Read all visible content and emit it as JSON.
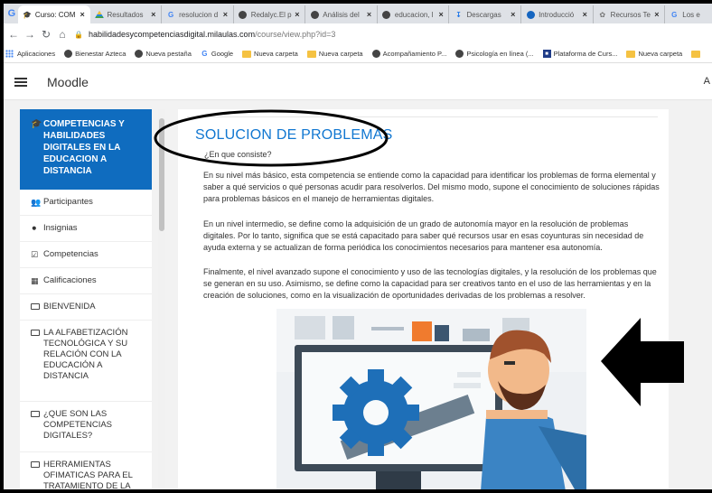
{
  "browser": {
    "tabs": [
      {
        "title": "Curso: COM",
        "favicon": "moodle-icon",
        "active": true
      },
      {
        "title": "Resultados",
        "favicon": "drive-icon"
      },
      {
        "title": "resolucion d",
        "favicon": "google-icon"
      },
      {
        "title": "Redalyc.El p",
        "favicon": "globe-icon"
      },
      {
        "title": "Análisis del",
        "favicon": "globe-icon"
      },
      {
        "title": "educacion, l",
        "favicon": "globe-icon"
      },
      {
        "title": "Descargas",
        "favicon": "download-icon"
      },
      {
        "title": "Introducció",
        "favicon": "globe-icon"
      },
      {
        "title": "Recursos Te",
        "favicon": "leaf-icon"
      },
      {
        "title": "Los e",
        "favicon": "google-icon"
      }
    ],
    "url_domain": "habilidadesycompetenciasdigital.milaulas.com",
    "url_path": "/course/view.php?id=3",
    "bookmarks": [
      {
        "label": "Aplicaciones",
        "icon": "apps-icon"
      },
      {
        "label": "Bienestar Azteca",
        "icon": "globe-icon"
      },
      {
        "label": "Nueva pestaña",
        "icon": "globe-icon"
      },
      {
        "label": "Google",
        "icon": "google-icon"
      },
      {
        "label": "Nueva carpeta",
        "icon": "folder-icon"
      },
      {
        "label": "Nueva carpeta",
        "icon": "folder-icon"
      },
      {
        "label": "Acompañamiento P...",
        "icon": "globe-icon"
      },
      {
        "label": "Psicología en línea (...",
        "icon": "globe-icon"
      },
      {
        "label": "Plataforma de Curs...",
        "icon": "platform-icon"
      },
      {
        "label": "Nueva carpeta",
        "icon": "folder-icon"
      }
    ]
  },
  "moodle": {
    "brand": "Moodle",
    "corner_letter": "A"
  },
  "drawer": {
    "course_title": "COMPETENCIAS Y HABILIDADES DIGITALES EN LA EDUCACION A DISTANCIA",
    "items": [
      {
        "label": "Participantes",
        "icon": "users-icon"
      },
      {
        "label": "Insignias",
        "icon": "badge-icon"
      },
      {
        "label": "Competencias",
        "icon": "checkbox-icon"
      },
      {
        "label": "Calificaciones",
        "icon": "table-icon"
      },
      {
        "label": "BIENVENIDA",
        "icon": "section-icon"
      },
      {
        "label": "LA ALFABETIZACIÓN TECNOLÓGICA Y SU RELACIÓN CON LA EDUCACIÓN A DISTANCIA",
        "icon": "section-icon"
      },
      {
        "label": "¿QUE SON LAS COMPETENCIAS DIGITALES?",
        "icon": "section-icon"
      },
      {
        "label": "HERRAMIENTAS OFIMATICAS PARA EL TRATAMIENTO DE LA",
        "icon": "section-icon"
      }
    ]
  },
  "content": {
    "title": "SOLUCION DE PROBLEMAS",
    "question": "¿En que consiste?",
    "paragraphs": [
      "En su nivel más básico, esta competencia se entiende como la capacidad para identificar los problemas de forma elemental y saber a qué servicios o qué personas acudir para resolverlos. Del mismo modo, supone el conocimiento de soluciones rápidas para problemas básicos en el manejo de herramientas digitales.",
      "En un nivel intermedio, se define como la adquisición de un grado de autonomía mayor en la resolución de problemas digitales. Por lo tanto, significa que  se está capacitado para saber qué recursos usar en esas coyunturas sin necesidad de ayuda externa y se actualizan de forma periódica los conocimientos necesarios para mantener esa autonomía.",
      "Finalmente, el nivel avanzado supone  el conocimiento y uso de las tecnologías digitales, y la resolución de los problemas que se generan en su uso. Asimismo, se define como la capacidad para ser creativos tanto en el uso de las herramientas y en la creación de soluciones, como en la visualización de oportunidades derivadas de los problemas a resolver."
    ],
    "illustration": "man-repairing-monitor-with-gear-and-wrench"
  },
  "annotations": {
    "oval": "hand-drawn-oval-around-title",
    "arrow": "black-arrow-pointing-left",
    "colors": {
      "oval": "#000000",
      "arrow": "#000000"
    }
  },
  "colors": {
    "moodle_blue": "#0f6cbf",
    "title_blue": "#1177d1",
    "page_bg": "#f2f2f2"
  }
}
